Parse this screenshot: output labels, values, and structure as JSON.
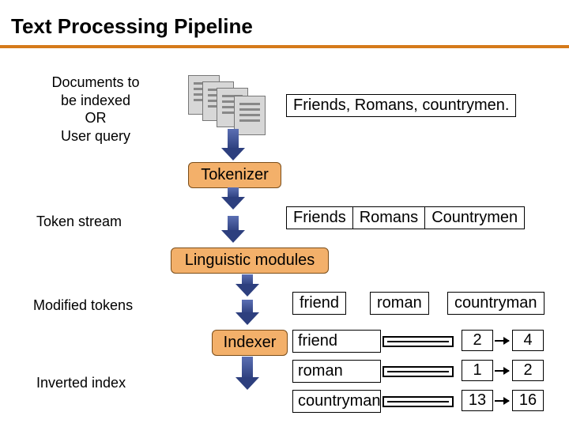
{
  "title": "Text Processing Pipeline",
  "captions": {
    "input": "Documents to\nbe indexed\nOR\nUser query",
    "token_stream": "Token stream",
    "modified_tokens": "Modified tokens",
    "inverted_index": "Inverted index"
  },
  "stages": {
    "tokenizer": "Tokenizer",
    "linguistic": "Linguistic modules",
    "indexer": "Indexer"
  },
  "input_text": "Friends, Romans, countrymen.",
  "token_stream": [
    "Friends",
    "Romans",
    "Countrymen"
  ],
  "modified_tokens": [
    "friend",
    "roman",
    "countryman"
  ],
  "inverted_index": [
    {
      "term": "friend",
      "postings": [
        2,
        4
      ]
    },
    {
      "term": "roman",
      "postings": [
        1,
        2
      ]
    },
    {
      "term": "countryman",
      "postings": [
        13,
        16
      ]
    }
  ]
}
